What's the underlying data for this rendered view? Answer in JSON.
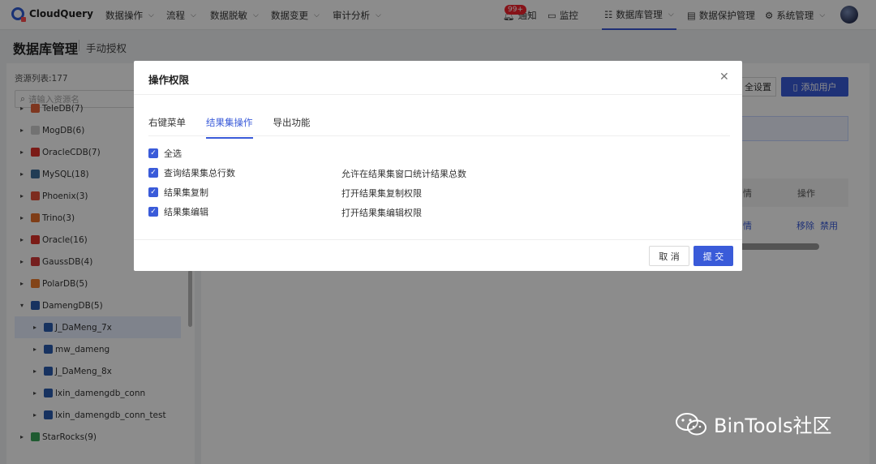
{
  "app": {
    "name": "CloudQuery",
    "brand_color": "#3a5bd9"
  },
  "nav": {
    "items": [
      "数据操作",
      "流程",
      "数据脱敏",
      "数据变更",
      "审计分析"
    ],
    "right_items": [
      "通知",
      "监控",
      "数据库管理",
      "数据保护管理",
      "系统管理"
    ],
    "badge": "99+",
    "active": "数据库管理"
  },
  "page": {
    "title": "数据库管理",
    "subtitle": "手动授权"
  },
  "resources": {
    "count_label": "资源列表:177",
    "search_placeholder": "请输入资源名",
    "tree": [
      {
        "label": "TeleDB(7)",
        "icon_color": "#e5643b",
        "level": 0
      },
      {
        "label": "MogDB(6)",
        "icon_color": "#d0d0d0",
        "level": 0
      },
      {
        "label": "OracleCDB(7)",
        "icon_color": "#e0322b",
        "level": 0
      },
      {
        "label": "MySQL(18)",
        "icon_color": "#3e6f9c",
        "level": 0
      },
      {
        "label": "Phoenix(3)",
        "icon_color": "#e4513a",
        "level": 0
      },
      {
        "label": "Trino(3)",
        "icon_color": "#e8702a",
        "level": 0
      },
      {
        "label": "Oracle(16)",
        "icon_color": "#e0322b",
        "level": 0
      },
      {
        "label": "GaussDB(4)",
        "icon_color": "#d63a3a",
        "level": 0
      },
      {
        "label": "PolarDB(5)",
        "icon_color": "#ef7d2c",
        "level": 0
      },
      {
        "label": "DamengDB(5)",
        "icon_color": "#2a5bb0",
        "level": 0,
        "expanded": true
      },
      {
        "label": "J_DaMeng_7x",
        "icon_color": "#2a5bb0",
        "level": 1,
        "selected": true
      },
      {
        "label": "mw_dameng",
        "icon_color": "#2a5bb0",
        "level": 1
      },
      {
        "label": "J_DaMeng_8x",
        "icon_color": "#2a5bb0",
        "level": 1
      },
      {
        "label": "lxin_damengdb_conn",
        "icon_color": "#2a5bb0",
        "level": 1
      },
      {
        "label": "lxin_damengdb_conn_test",
        "icon_color": "#2a5bb0",
        "level": 1
      },
      {
        "label": "StarRocks(9)",
        "icon_color": "#3aa65a",
        "level": 0
      }
    ]
  },
  "main": {
    "btn_settings": "全设置",
    "btn_add_user": "添加用户",
    "col_detail": "情",
    "col_action": "操作",
    "row_detail": "情",
    "row_remove": "移除",
    "row_disable": "禁用"
  },
  "modal": {
    "title": "操作权限",
    "tabs": [
      "右键菜单",
      "结果集操作",
      "导出功能"
    ],
    "active_tab": 1,
    "options": [
      {
        "label": "全选",
        "desc": "",
        "checked": true
      },
      {
        "label": "查询结果集总行数",
        "desc": "允许在结果集窗口统计结果总数",
        "checked": true
      },
      {
        "label": "结果集复制",
        "desc": "打开结果集复制权限",
        "checked": true
      },
      {
        "label": "结果集编辑",
        "desc": "打开结果集编辑权限",
        "checked": true
      }
    ],
    "cancel": "取 消",
    "submit": "提 交"
  },
  "watermark": "BinTools社区"
}
